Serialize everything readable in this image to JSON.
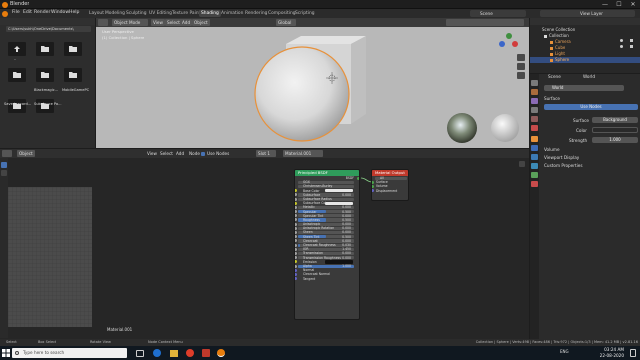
{
  "window": {
    "title": "Blender",
    "controls": [
      "—",
      "☐",
      "✕"
    ]
  },
  "menubar": {
    "items": [
      "File",
      "Edit",
      "Render",
      "Window",
      "Help"
    ],
    "workspace_tabs": [
      "Layout",
      "Modeling",
      "Sculpting",
      "UV Editing",
      "Texture Paint",
      "Shading",
      "Animation",
      "Rendering",
      "Compositing",
      "Scripting"
    ],
    "active_tab": "Shading",
    "scene_label": "Scene",
    "view_layer_label": "View Layer"
  },
  "file_browser": {
    "path": "C:\\Users\\sukh\\OneDrive\\Documents\\",
    "items": [
      {
        "label": "..",
        "kind": "parent"
      },
      {
        "label": "",
        "kind": "folder"
      },
      {
        "label": "",
        "kind": "folder"
      },
      {
        "label": "",
        "kind": "folder"
      },
      {
        "label": "Blackmagic...",
        "kind": "folder"
      },
      {
        "label": "MobileGamePC",
        "kind": "folder"
      },
      {
        "label": "Saved record...",
        "kind": "folder"
      },
      {
        "label": "Substance Pa...",
        "kind": "folder"
      }
    ]
  },
  "viewport": {
    "mode": "Object Mode",
    "menu": [
      "View",
      "Select",
      "Add",
      "Object"
    ],
    "orientation": "Global",
    "overlay_line1": "User Perspective",
    "overlay_line2": "(1) Collection | Sphere"
  },
  "outliner": {
    "rows": [
      {
        "label": "Scene Collection",
        "indent": 0,
        "selected": false
      },
      {
        "label": "Collection",
        "indent": 1,
        "selected": false
      },
      {
        "label": "Camera",
        "indent": 2,
        "selected": false
      },
      {
        "label": "Cube",
        "indent": 2,
        "selected": false
      },
      {
        "label": "Light",
        "indent": 2,
        "selected": false
      },
      {
        "label": "Sphere",
        "indent": 2,
        "selected": true
      }
    ]
  },
  "properties": {
    "header_scene": "Scene",
    "header_world": "World",
    "world_name": "World",
    "surface_label": "Surface",
    "use_nodes_label": "Use Nodes",
    "surface_field_label": "Surface",
    "surface_value": "Background",
    "color_label": "Color",
    "strength_label": "Strength",
    "strength_value": "1.000",
    "volume_label": "Volume",
    "viewport_display_label": "Viewport Display",
    "custom_props_label": "Custom Properties"
  },
  "node_editor": {
    "header_items": [
      "Object",
      "View",
      "Select",
      "Add",
      "Node"
    ],
    "use_nodes_label": "Use Nodes",
    "slot_label": "Slot 1",
    "material_name": "Material.001",
    "footer_material": "Material.001",
    "principled": {
      "title": "Principled BSDF",
      "output_label": "BSDF",
      "distribution": "GGX",
      "subsurface_method": "Christensen-Burley",
      "rows": [
        {
          "label": "Base Color",
          "kind": "color",
          "value": "",
          "fill": 0
        },
        {
          "label": "Subsurface",
          "kind": "slider",
          "value": "0.000",
          "fill": 0
        },
        {
          "label": "Subsurface Radius",
          "kind": "select",
          "value": "",
          "fill": 0
        },
        {
          "label": "Subsurface Color",
          "kind": "color",
          "value": "",
          "fill": 0
        },
        {
          "label": "Metallic",
          "kind": "slider",
          "value": "0.000",
          "fill": 0
        },
        {
          "label": "Specular",
          "kind": "slider",
          "value": "0.500",
          "fill": 0.5
        },
        {
          "label": "Specular Tint",
          "kind": "slider",
          "value": "0.000",
          "fill": 0
        },
        {
          "label": "Roughness",
          "kind": "slider",
          "value": "0.500",
          "fill": 0.5
        },
        {
          "label": "Anisotropic",
          "kind": "slider",
          "value": "0.000",
          "fill": 0
        },
        {
          "label": "Anisotropic Rotation",
          "kind": "slider",
          "value": "0.000",
          "fill": 0
        },
        {
          "label": "Sheen",
          "kind": "slider",
          "value": "0.000",
          "fill": 0
        },
        {
          "label": "Sheen Tint",
          "kind": "slider",
          "value": "0.500",
          "fill": 0.5
        },
        {
          "label": "Clearcoat",
          "kind": "slider",
          "value": "0.000",
          "fill": 0
        },
        {
          "label": "Clearcoat Roughness",
          "kind": "slider",
          "value": "0.030",
          "fill": 0.03
        },
        {
          "label": "IOR",
          "kind": "slider",
          "value": "1.450",
          "fill": 0
        },
        {
          "label": "Transmission",
          "kind": "slider",
          "value": "0.000",
          "fill": 0
        },
        {
          "label": "Transmission Roughness",
          "kind": "slider",
          "value": "0.000",
          "fill": 0
        },
        {
          "label": "Emission",
          "kind": "color-dark",
          "value": "",
          "fill": 0
        },
        {
          "label": "Alpha",
          "kind": "slider",
          "value": "1.000",
          "fill": 1
        },
        {
          "label": "Normal",
          "kind": "plain",
          "value": "",
          "fill": 0
        },
        {
          "label": "Clearcoat Normal",
          "kind": "plain",
          "value": "",
          "fill": 0
        },
        {
          "label": "Tangent",
          "kind": "plain",
          "value": "",
          "fill": 0
        }
      ]
    },
    "material_output": {
      "title": "Material Output",
      "target": "All",
      "rows": [
        "Surface",
        "Volume",
        "Displacement"
      ]
    }
  },
  "statusbar": {
    "left1": "Select",
    "left2": "Box Select",
    "left3": "Rotate View",
    "left4": "Node Context Menu",
    "right": "Collection | Sphere | Verts:498 | Faces:486 | Tris:972 | Objects:1/3 | Mem: 41.2 MB | v2.81.16"
  },
  "taskbar": {
    "search_placeholder": "Type here to search",
    "lang": "ENG",
    "time": "03:24 AM",
    "date": "22-08-2020"
  },
  "colors": {
    "accent_blue": "#4772b3",
    "principled_header": "#2f9c5b",
    "output_header": "#c0392b",
    "selection": "#e8913a"
  }
}
